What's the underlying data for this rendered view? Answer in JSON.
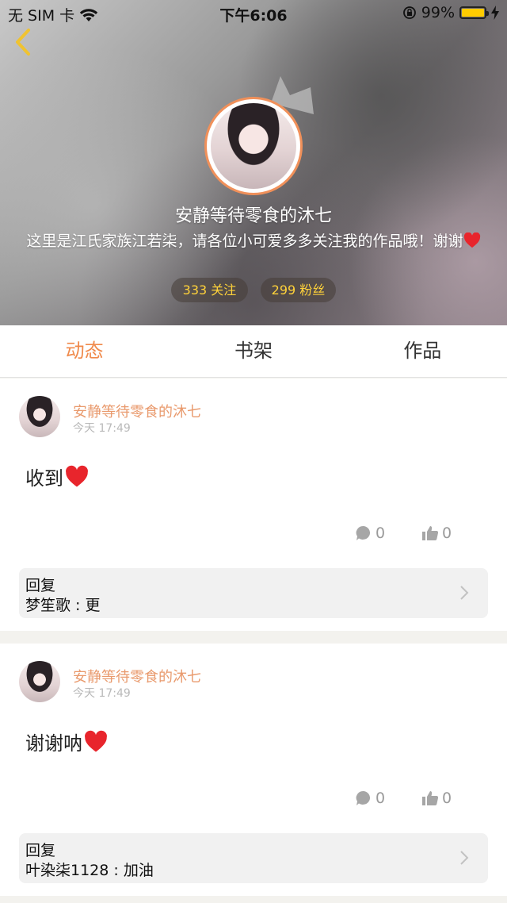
{
  "status_bar": {
    "carrier": "无 SIM 卡",
    "time": "下午6:06",
    "battery": "99%",
    "battery_level": 0.99
  },
  "profile": {
    "nickname": "安静等待零食的沐七",
    "bio": "这里是江氏家族江若柒，请各位小可爱多多关注我的作品哦！谢谢",
    "follow": "333 关注",
    "fans": "299 粉丝"
  },
  "tabs": [
    {
      "label": "动态",
      "active": true
    },
    {
      "label": "书架",
      "active": false
    },
    {
      "label": "作品",
      "active": false
    }
  ],
  "posts": [
    {
      "author": "安静等待零食的沐七",
      "time": "今天 17:49",
      "text": "收到",
      "comments": "0",
      "likes": "0",
      "reply_label": "回复",
      "reply_text": "梦笙歌 : 更"
    },
    {
      "author": "安静等待零食的沐七",
      "time": "今天 17:49",
      "text": "谢谢呐",
      "comments": "0",
      "likes": "0",
      "reply_label": "回复",
      "reply_text": "叶染柒1128 : 加油"
    }
  ],
  "colors": {
    "accent": "#f08a4b",
    "name_color": "#e99a6d",
    "pill_text": "#ffd23a",
    "battery": "#ffcc00"
  }
}
